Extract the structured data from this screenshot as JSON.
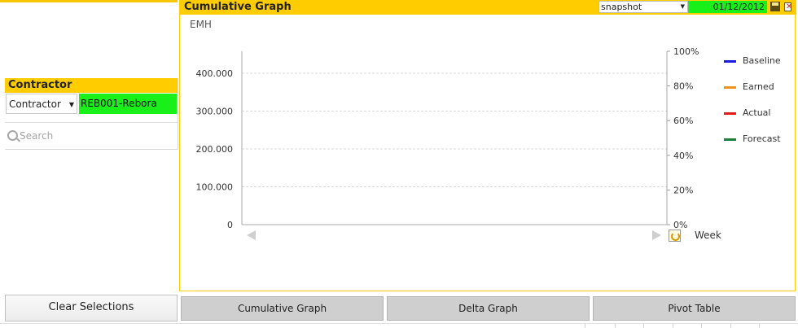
{
  "left_panel_top": {
    "label": ""
  },
  "contractor": {
    "title": "Contractor",
    "field_select": "Contractor",
    "selected_value": "REB001-Rebora",
    "search_placeholder": "Search"
  },
  "graph": {
    "title": "Cumulative Graph",
    "snapshot_select": "snapshot",
    "date_value": "01/12/2012",
    "y_unit": "EMH",
    "x_label": "Week"
  },
  "chart_data": {
    "type": "line",
    "title": "Cumulative Graph",
    "ylabel": "EMH",
    "xlabel": "Week",
    "x": [],
    "ylim": [
      0,
      400000
    ],
    "y_ticks": [
      "0",
      "100.000",
      "200.000",
      "300.000",
      "400.000"
    ],
    "y2lim": [
      0,
      100
    ],
    "y2_ticks": [
      "0%",
      "20%",
      "40%",
      "60%",
      "80%",
      "100%"
    ],
    "grid": true,
    "legend_position": "right",
    "series": [
      {
        "name": "Baseline",
        "color": "#1a1adf",
        "values": []
      },
      {
        "name": "Earned",
        "color": "#f0921e",
        "values": []
      },
      {
        "name": "Actual",
        "color": "#e31b1b",
        "values": []
      },
      {
        "name": "Forecast",
        "color": "#1e7d3a",
        "values": []
      }
    ]
  },
  "buttons": {
    "clear_selections": "Clear Selections",
    "tab_cumulative": "Cumulative Graph",
    "tab_delta": "Delta Graph",
    "tab_pivot": "Pivot Table"
  },
  "colors": {
    "header": "#ffcc00",
    "selected": "#19ef19"
  }
}
